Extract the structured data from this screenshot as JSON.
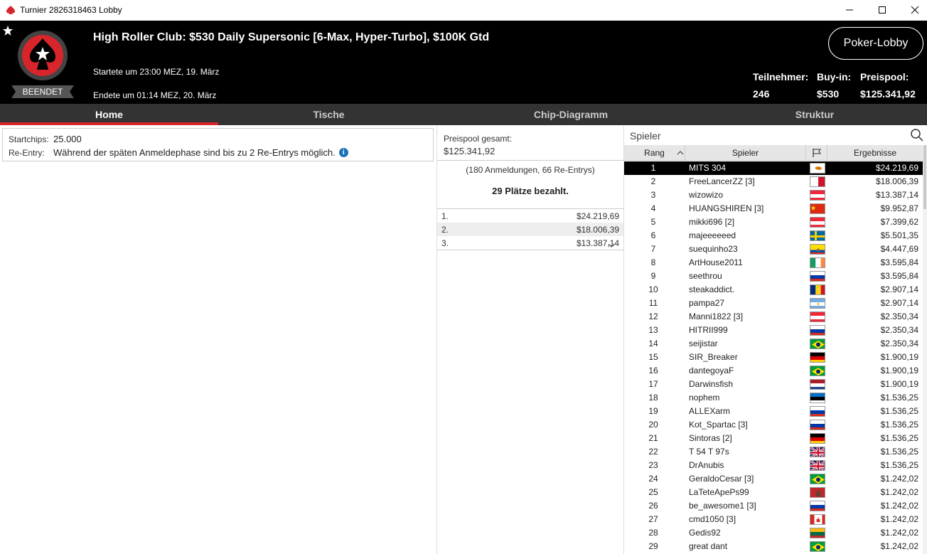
{
  "window": {
    "title": "Turnier 2826318463 Lobby"
  },
  "header": {
    "status": "BEENDET",
    "title": "High Roller Club: $530 Daily Supersonic [6-Max, Hyper-Turbo], $100K Gtd",
    "started": "Startete um 23:00 MEZ, 19. März",
    "ended": "Endete um 01:14 MEZ, 20. März",
    "lobby_button": "Poker-Lobby",
    "stats": {
      "players_label": "Teilnehmer:",
      "players_value": "246",
      "buyin_label": "Buy-in:",
      "buyin_value": "$530",
      "prize_label": "Preispool:",
      "prize_value": "$125.341,92"
    }
  },
  "tabs": [
    "Home",
    "Tische",
    "Chip-Diagramm",
    "Struktur"
  ],
  "info": {
    "startchips_label": "Startchips:",
    "startchips_value": "25.000",
    "reentry_label": "Re-Entry:",
    "reentry_value": "Während der späten Anmeldephase sind bis zu 2 Re-Entrys möglich."
  },
  "prizepool": {
    "label": "Preispool gesamt:",
    "value": "$125.341,92",
    "registrations": "(180 Anmeldungen, 66 Re-Entrys)",
    "paid": "29 Plätze bezahlt.",
    "payouts": [
      {
        "place": "1.",
        "amount": "$24.219,69"
      },
      {
        "place": "2.",
        "amount": "$18.006,39"
      },
      {
        "place": "3.",
        "amount": "$13.387,14"
      }
    ]
  },
  "players_panel": {
    "search_placeholder": "Spieler",
    "columns": {
      "rank": "Rang",
      "player": "Spieler",
      "result": "Ergebnisse"
    },
    "selected_index": 0,
    "rows": [
      {
        "rank": "1",
        "name": "MITS 304",
        "flag": "cy",
        "result": "$24.219,69"
      },
      {
        "rank": "2",
        "name": "FreeLancerZZ [3]",
        "flag": "mt",
        "result": "$18.006,39"
      },
      {
        "rank": "3",
        "name": "wizowizo",
        "flag": "at",
        "result": "$13.387,14"
      },
      {
        "rank": "4",
        "name": "HUANGSHIREN [3]",
        "flag": "cn",
        "result": "$9.952,87"
      },
      {
        "rank": "5",
        "name": "mikki696 [2]",
        "flag": "at",
        "result": "$7.399,62"
      },
      {
        "rank": "6",
        "name": "majeeeeeed",
        "flag": "se",
        "result": "$5.501,35"
      },
      {
        "rank": "7",
        "name": "suequinho23",
        "flag": "ec",
        "result": "$4.447,69"
      },
      {
        "rank": "8",
        "name": "ArtHouse2011",
        "flag": "ie",
        "result": "$3.595,84"
      },
      {
        "rank": "9",
        "name": "seethrou",
        "flag": "ru",
        "result": "$3.595,84"
      },
      {
        "rank": "10",
        "name": "steakaddict.",
        "flag": "ro",
        "result": "$2.907,14"
      },
      {
        "rank": "11",
        "name": "pampa27",
        "flag": "ar",
        "result": "$2.907,14"
      },
      {
        "rank": "12",
        "name": "Manni1822 [3]",
        "flag": "at",
        "result": "$2.350,34"
      },
      {
        "rank": "13",
        "name": "HITRII999",
        "flag": "ru",
        "result": "$2.350,34"
      },
      {
        "rank": "14",
        "name": "seijistar",
        "flag": "br",
        "result": "$2.350,34"
      },
      {
        "rank": "15",
        "name": "SIR_Breaker",
        "flag": "de",
        "result": "$1.900,19"
      },
      {
        "rank": "16",
        "name": "dantegoyaF",
        "flag": "br",
        "result": "$1.900,19"
      },
      {
        "rank": "17",
        "name": "Darwinsfish",
        "flag": "nl",
        "result": "$1.900,19"
      },
      {
        "rank": "18",
        "name": "nophem",
        "flag": "ee",
        "result": "$1.536,25"
      },
      {
        "rank": "19",
        "name": "ALLEXarm",
        "flag": "ru",
        "result": "$1.536,25"
      },
      {
        "rank": "20",
        "name": "Kot_Spartac [3]",
        "flag": "ru",
        "result": "$1.536,25"
      },
      {
        "rank": "21",
        "name": "Sintoras [2]",
        "flag": "de",
        "result": "$1.536,25"
      },
      {
        "rank": "22",
        "name": "T 54 T 97s",
        "flag": "gb",
        "result": "$1.536,25"
      },
      {
        "rank": "23",
        "name": "DrAnubis",
        "flag": "gb",
        "result": "$1.536,25"
      },
      {
        "rank": "24",
        "name": "GeraldoCesar [3]",
        "flag": "br",
        "result": "$1.242,02"
      },
      {
        "rank": "25",
        "name": "LaTeteApePs99",
        "flag": "ma",
        "result": "$1.242,02"
      },
      {
        "rank": "26",
        "name": "be_awesome1 [3]",
        "flag": "ru",
        "result": "$1.242,02"
      },
      {
        "rank": "27",
        "name": "cmd1050 [3]",
        "flag": "ca",
        "result": "$1.242,02"
      },
      {
        "rank": "28",
        "name": "Gedis92",
        "flag": "lt",
        "result": "$1.242,02"
      },
      {
        "rank": "29",
        "name": "great dant",
        "flag": "br",
        "result": "$1.242,02"
      }
    ]
  },
  "colors": {
    "accent": "#d7252b",
    "header_bg": "#000000",
    "tab_bg": "#333333",
    "info_icon": "#1a73b8"
  }
}
